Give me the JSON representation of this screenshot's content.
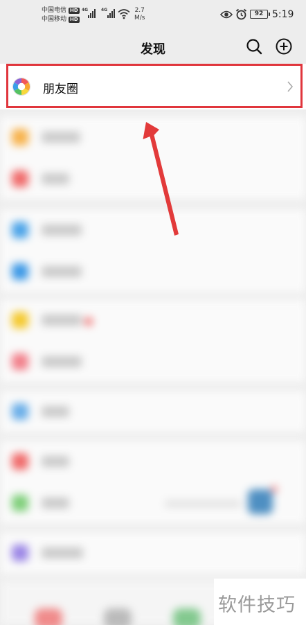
{
  "status_bar": {
    "carrier_1": "中国电信",
    "carrier_2": "中国移动",
    "hd": "HD",
    "network": "4G",
    "speed_value": "2.7",
    "speed_unit": "M/s",
    "battery": "92",
    "time": "5:19"
  },
  "header": {
    "title": "发现"
  },
  "moments": {
    "label": "朋友圈"
  },
  "watermark": {
    "text": "软件技巧"
  },
  "colors": {
    "highlight": "#e0353c",
    "background": "#ededed"
  }
}
